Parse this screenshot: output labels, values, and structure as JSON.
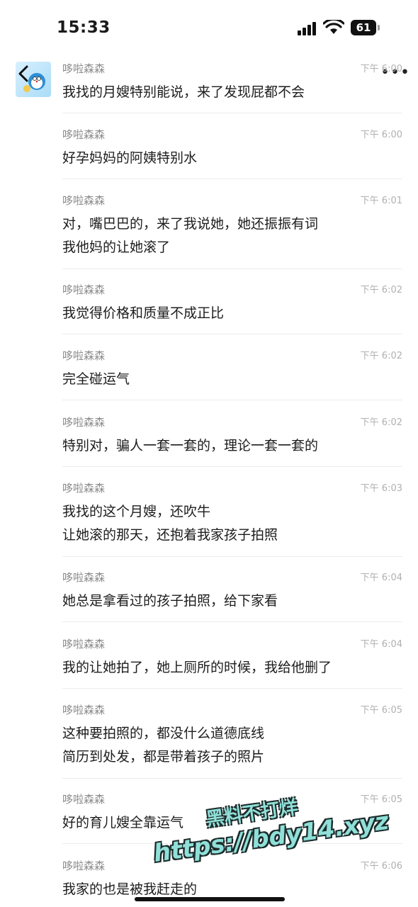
{
  "status_bar": {
    "time": "15:33",
    "battery": "61"
  },
  "messages": [
    {
      "sender": "哆啦森森",
      "time": "下午 6:00",
      "lines": [
        "我找的月嫂特别能说，来了发现屁都不会"
      ]
    },
    {
      "sender": "哆啦森森",
      "time": "下午 6:00",
      "lines": [
        "好孕妈妈的阿姨特别水"
      ]
    },
    {
      "sender": "哆啦森森",
      "time": "下午 6:01",
      "lines": [
        "对，嘴巴巴的，来了我说她，她还振振有词",
        "我他妈的让她滚了"
      ]
    },
    {
      "sender": "哆啦森森",
      "time": "下午 6:02",
      "lines": [
        "我觉得价格和质量不成正比"
      ]
    },
    {
      "sender": "哆啦森森",
      "time": "下午 6:02",
      "lines": [
        "完全碰运气"
      ]
    },
    {
      "sender": "哆啦森森",
      "time": "下午 6:02",
      "lines": [
        "特别对，骗人一套一套的，理论一套一套的"
      ]
    },
    {
      "sender": "哆啦森森",
      "time": "下午 6:03",
      "lines": [
        "我找的这个月嫂，还吹牛",
        "让她滚的那天，还抱着我家孩子拍照"
      ]
    },
    {
      "sender": "哆啦森森",
      "time": "下午 6:04",
      "lines": [
        "她总是拿看过的孩子拍照，给下家看"
      ]
    },
    {
      "sender": "哆啦森森",
      "time": "下午 6:04",
      "lines": [
        "我的让她拍了，她上厕所的时候，我给他删了"
      ]
    },
    {
      "sender": "哆啦森森",
      "time": "下午 6:05",
      "lines": [
        "这种要拍照的，都没什么道德底线",
        "简历到处发，都是带着孩子的照片"
      ]
    },
    {
      "sender": "哆啦森森",
      "time": "下午 6:05",
      "lines": [
        "好的育儿嫂全靠运气"
      ]
    },
    {
      "sender": "哆啦森森",
      "time": "下午 6:06",
      "lines": [
        "我家的也是被我赶走的"
      ]
    }
  ],
  "watermark": {
    "line1": "黑料不打烊",
    "line2": "https://bdy14.xyz"
  },
  "icons": {
    "back": "chevron-left-icon",
    "more": "more-dots-icon",
    "signal": "signal-icon",
    "wifi": "wifi-icon",
    "battery": "battery-icon"
  },
  "colors": {
    "sender": "#8a8a8a",
    "time": "#b0b0b0",
    "text": "#1c1c1c",
    "divider": "#ececec",
    "watermark": "#8fe0d8"
  }
}
